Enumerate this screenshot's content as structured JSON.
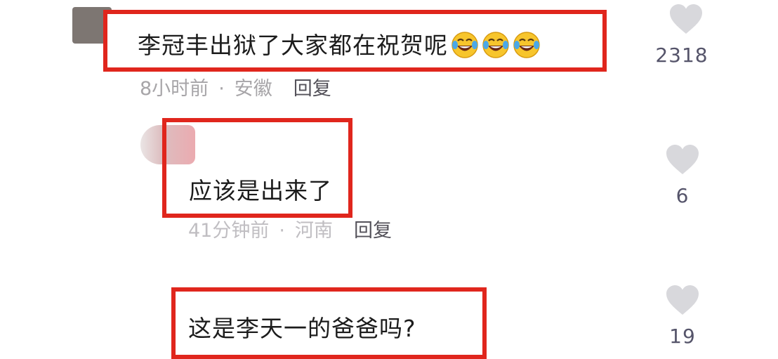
{
  "comments": [
    {
      "text": "李冠丰出狱了大家都在祝贺呢",
      "emojis": [
        "laughing-tears-icon",
        "laughing-tears-icon",
        "laughing-tears-icon"
      ],
      "time": "8小时前",
      "location": "安徽",
      "reply_label": "回复",
      "likes": "2318"
    },
    {
      "text": "应该是出来了",
      "time": "41分钟前",
      "location": "河南",
      "reply_label": "回复",
      "likes": "6"
    },
    {
      "text": "这是李天一的爸爸吗?",
      "likes": "19"
    }
  ],
  "meta_separator": "·",
  "colors": {
    "highlight_border": "#e0261d",
    "heart": "#d8d8dc",
    "meta_text": "#a7a5a8",
    "reply_text": "#54525a",
    "like_count": "#55546a"
  }
}
